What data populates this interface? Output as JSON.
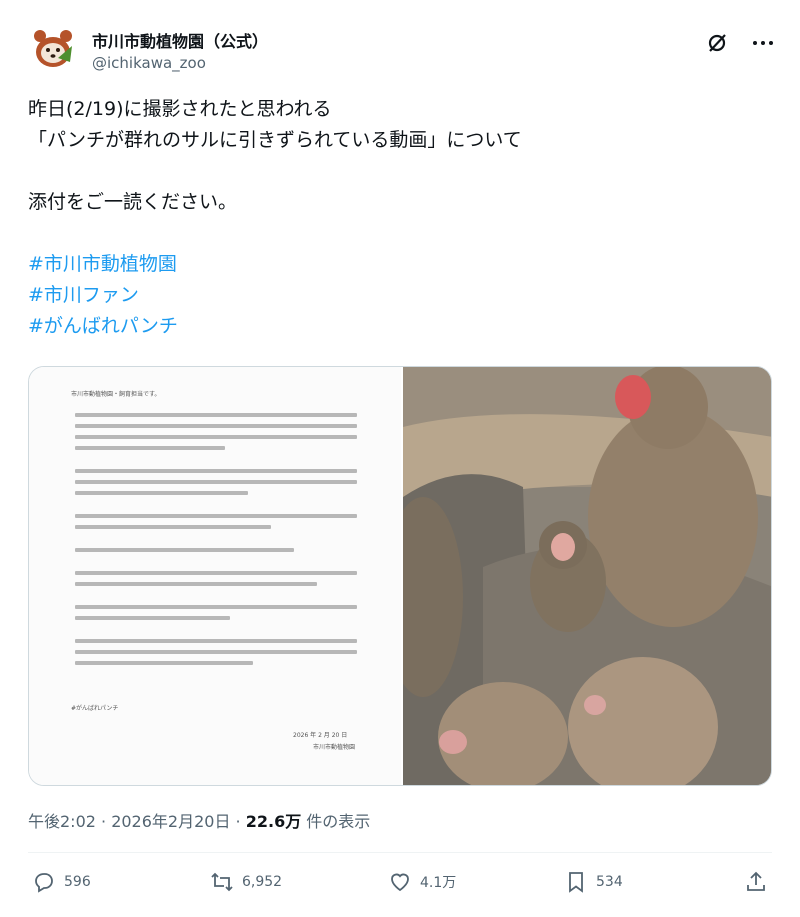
{
  "account": {
    "display_name": "市川市動植物園（公式）",
    "handle": "@ichikawa_zoo"
  },
  "header_icons": [
    "grok-icon",
    "more-icon"
  ],
  "post": {
    "line1": "昨日(2/19)に撮影されたと思われる",
    "line2": "「パンチが群れのサルに引きずられている動画」について",
    "line3": "添付をご一読ください。",
    "hashtags": [
      "#市川市動植物園",
      "#市川ファン",
      "#がんばれパンチ"
    ]
  },
  "media": {
    "doc_heading": "市川市動植物園・飼育担当です。",
    "doc_hashtag": "#がんばれパンチ",
    "doc_date": "2026 年 2 月 20 日",
    "doc_signature": "市川市動植物園"
  },
  "meta": {
    "time": "午後2:02 · 2026年2月20日 · ",
    "views": "22.6万",
    "views_suffix": " 件の表示"
  },
  "actions": {
    "replies": "596",
    "reposts": "6,952",
    "likes": "4.1万",
    "bookmarks": "534"
  },
  "colors": {
    "link": "#1d9bf0",
    "secondary_text": "#536471",
    "primary_text": "#0f1419"
  }
}
